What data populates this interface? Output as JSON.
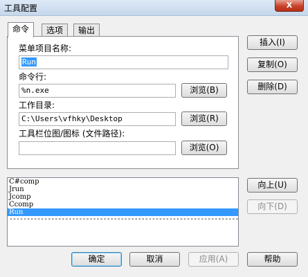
{
  "window": {
    "title": "工具配置",
    "close_label": "X"
  },
  "tabs": [
    {
      "label": "命令",
      "active": true
    },
    {
      "label": "选项",
      "active": false
    },
    {
      "label": "输出",
      "active": false
    }
  ],
  "form": {
    "menu_name_label": "菜单项目名称:",
    "menu_name_value": "Run",
    "command_label": "命令行:",
    "command_value": "%n.exe",
    "workdir_label": "工作目录:",
    "workdir_value": "C:\\Users\\vfhky\\Desktop",
    "toolbar_icon_label": "工具栏位图/图标 (文件路径):",
    "toolbar_icon_value": "",
    "browse_b": "浏览(B)",
    "browse_r": "浏览(R)",
    "browse_o": "浏览(O)"
  },
  "side_buttons": {
    "insert": "插入(I)",
    "copy": "复制(O)",
    "delete": "删除(D)",
    "up": "向上(U)",
    "down": "向下(D)"
  },
  "tool_list": {
    "items": [
      "C#comp",
      "Jrun",
      "Jcomp",
      "Ccomp",
      "Run"
    ],
    "selected": "Run",
    "separator": "------------------------------------------------------------------------------------------"
  },
  "footer": {
    "ok": "确定",
    "cancel": "取消",
    "apply": "应用(A)",
    "help": "帮助"
  }
}
